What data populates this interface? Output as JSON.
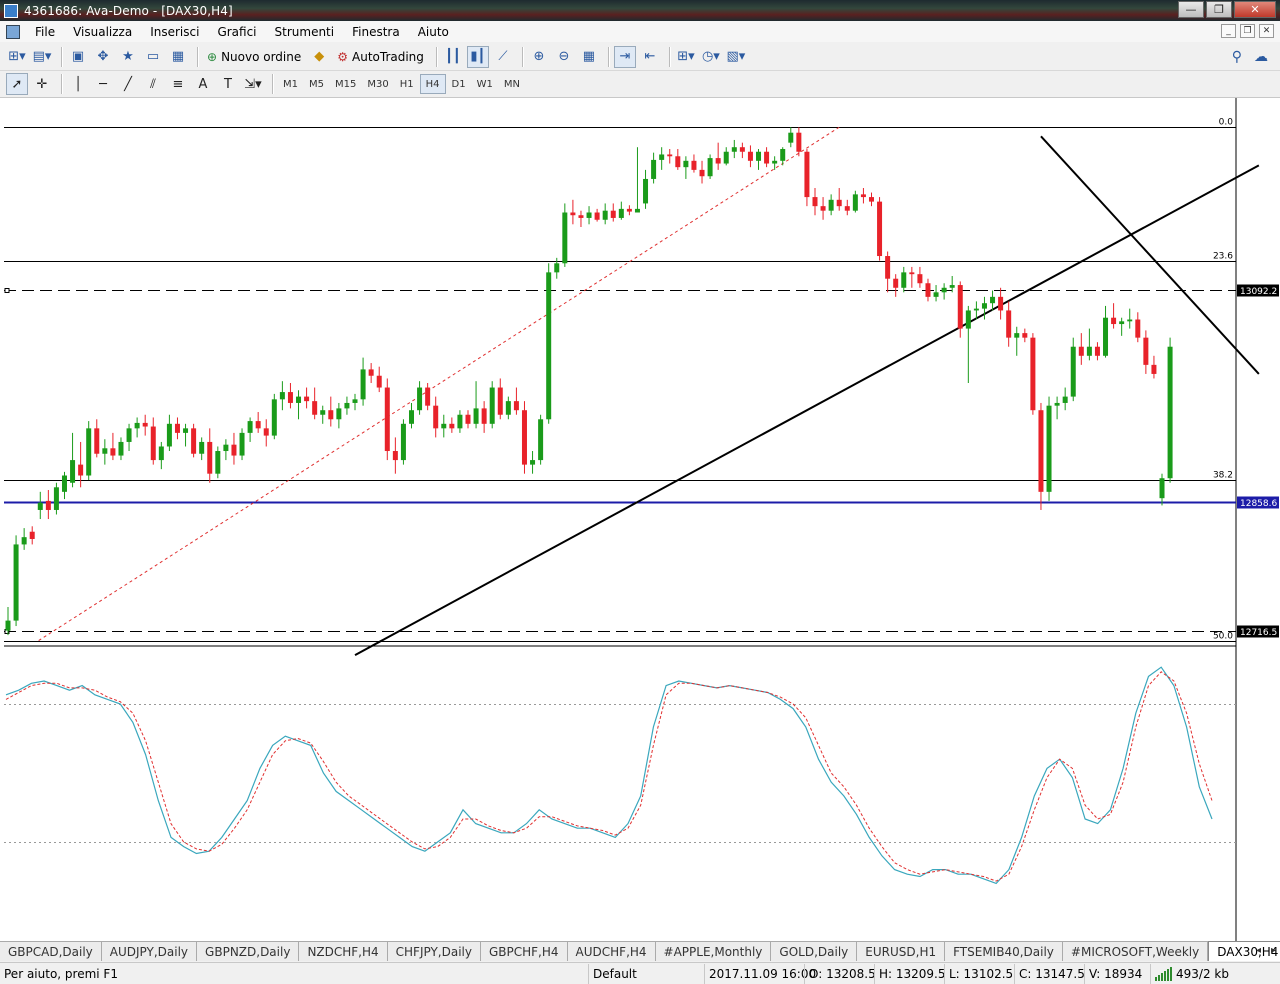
{
  "window": {
    "title": "4361686: Ava-Demo - [DAX30,H4]",
    "buttons": {
      "minimize": "—",
      "restore": "❐",
      "close": "✕"
    }
  },
  "menu": {
    "items": [
      "File",
      "Visualizza",
      "Inserisci",
      "Grafici",
      "Strumenti",
      "Finestra",
      "Aiuto"
    ]
  },
  "toolbar": {
    "new_order": "Nuovo ordine",
    "autotrading": "AutoTrading",
    "timeframes": [
      "M1",
      "M5",
      "M15",
      "M30",
      "H1",
      "H4",
      "D1",
      "W1",
      "MN"
    ],
    "active_timeframe": "H4"
  },
  "chart_data": {
    "type": "candlestick",
    "symbol": "DAX30",
    "timeframe": "H4",
    "price_range": [
      12700,
      13280
    ],
    "indicator_range": [
      0,
      100
    ],
    "fib_levels": [
      {
        "label": "0.0",
        "price": 13272
      },
      {
        "label": "23.6",
        "price": 13124
      },
      {
        "label": "38.2",
        "price": 12883
      },
      {
        "label": "50.0",
        "price": 12706
      }
    ],
    "price_labels": [
      {
        "text": "13092.2",
        "price": 13092.2,
        "style": "dash"
      },
      {
        "text": "12858.6",
        "price": 12858.6,
        "style": "blue"
      },
      {
        "text": "12716.5",
        "price": 12716.5,
        "style": "dash"
      }
    ],
    "candles": [
      {
        "o": 12717,
        "h": 12743,
        "l": 12712,
        "c": 12728
      },
      {
        "o": 12728,
        "h": 12822,
        "l": 12722,
        "c": 12812
      },
      {
        "o": 12812,
        "h": 12830,
        "l": 12806,
        "c": 12820
      },
      {
        "o": 12826,
        "h": 12832,
        "l": 12812,
        "c": 12818
      },
      {
        "o": 12850,
        "h": 12870,
        "l": 12840,
        "c": 12858
      },
      {
        "o": 12860,
        "h": 12872,
        "l": 12840,
        "c": 12850
      },
      {
        "o": 12850,
        "h": 12880,
        "l": 12845,
        "c": 12875
      },
      {
        "o": 12870,
        "h": 12892,
        "l": 12862,
        "c": 12888
      },
      {
        "o": 12880,
        "h": 12935,
        "l": 12875,
        "c": 12905
      },
      {
        "o": 12900,
        "h": 12925,
        "l": 12875,
        "c": 12888
      },
      {
        "o": 12888,
        "h": 12948,
        "l": 12883,
        "c": 12940
      },
      {
        "o": 12940,
        "h": 12950,
        "l": 12908,
        "c": 12912
      },
      {
        "o": 12912,
        "h": 12928,
        "l": 12900,
        "c": 12918
      },
      {
        "o": 12918,
        "h": 12935,
        "l": 12905,
        "c": 12910
      },
      {
        "o": 12910,
        "h": 12930,
        "l": 12905,
        "c": 12925
      },
      {
        "o": 12925,
        "h": 12945,
        "l": 12915,
        "c": 12940
      },
      {
        "o": 12940,
        "h": 12952,
        "l": 12930,
        "c": 12946
      },
      {
        "o": 12946,
        "h": 12955,
        "l": 12932,
        "c": 12942
      },
      {
        "o": 12942,
        "h": 12952,
        "l": 12900,
        "c": 12905
      },
      {
        "o": 12905,
        "h": 12925,
        "l": 12895,
        "c": 12920
      },
      {
        "o": 12920,
        "h": 12955,
        "l": 12915,
        "c": 12945
      },
      {
        "o": 12945,
        "h": 12952,
        "l": 12928,
        "c": 12935
      },
      {
        "o": 12935,
        "h": 12945,
        "l": 12920,
        "c": 12940
      },
      {
        "o": 12940,
        "h": 12945,
        "l": 12908,
        "c": 12912
      },
      {
        "o": 12912,
        "h": 12930,
        "l": 12905,
        "c": 12925
      },
      {
        "o": 12925,
        "h": 12940,
        "l": 12880,
        "c": 12890
      },
      {
        "o": 12890,
        "h": 12920,
        "l": 12885,
        "c": 12915
      },
      {
        "o": 12915,
        "h": 12928,
        "l": 12905,
        "c": 12922
      },
      {
        "o": 12922,
        "h": 12935,
        "l": 12900,
        "c": 12910
      },
      {
        "o": 12910,
        "h": 12940,
        "l": 12905,
        "c": 12935
      },
      {
        "o": 12935,
        "h": 12952,
        "l": 12925,
        "c": 12948
      },
      {
        "o": 12948,
        "h": 12958,
        "l": 12935,
        "c": 12940
      },
      {
        "o": 12940,
        "h": 12950,
        "l": 12920,
        "c": 12932
      },
      {
        "o": 12932,
        "h": 12978,
        "l": 12928,
        "c": 12972
      },
      {
        "o": 12972,
        "h": 12992,
        "l": 12960,
        "c": 12980
      },
      {
        "o": 12980,
        "h": 12990,
        "l": 12962,
        "c": 12968
      },
      {
        "o": 12968,
        "h": 12982,
        "l": 12950,
        "c": 12975
      },
      {
        "o": 12975,
        "h": 12985,
        "l": 12962,
        "c": 12970
      },
      {
        "o": 12970,
        "h": 12985,
        "l": 12950,
        "c": 12955
      },
      {
        "o": 12955,
        "h": 12965,
        "l": 12945,
        "c": 12960
      },
      {
        "o": 12960,
        "h": 12975,
        "l": 12942,
        "c": 12950
      },
      {
        "o": 12950,
        "h": 12968,
        "l": 12940,
        "c": 12962
      },
      {
        "o": 12962,
        "h": 12975,
        "l": 12955,
        "c": 12968
      },
      {
        "o": 12968,
        "h": 12978,
        "l": 12960,
        "c": 12972
      },
      {
        "o": 12972,
        "h": 13018,
        "l": 12965,
        "c": 13005
      },
      {
        "o": 13005,
        "h": 13012,
        "l": 12990,
        "c": 12998
      },
      {
        "o": 12998,
        "h": 13008,
        "l": 12980,
        "c": 12985
      },
      {
        "o": 12985,
        "h": 12995,
        "l": 12905,
        "c": 12915
      },
      {
        "o": 12915,
        "h": 12930,
        "l": 12890,
        "c": 12905
      },
      {
        "o": 12905,
        "h": 12950,
        "l": 12900,
        "c": 12945
      },
      {
        "o": 12945,
        "h": 12968,
        "l": 12940,
        "c": 12960
      },
      {
        "o": 12960,
        "h": 12992,
        "l": 12955,
        "c": 12985
      },
      {
        "o": 12985,
        "h": 12990,
        "l": 12960,
        "c": 12965
      },
      {
        "o": 12965,
        "h": 12975,
        "l": 12930,
        "c": 12940
      },
      {
        "o": 12940,
        "h": 12955,
        "l": 12930,
        "c": 12945
      },
      {
        "o": 12945,
        "h": 12952,
        "l": 12935,
        "c": 12940
      },
      {
        "o": 12940,
        "h": 12960,
        "l": 12935,
        "c": 12955
      },
      {
        "o": 12955,
        "h": 12960,
        "l": 12940,
        "c": 12945
      },
      {
        "o": 12945,
        "h": 12992,
        "l": 12940,
        "c": 12962
      },
      {
        "o": 12962,
        "h": 12970,
        "l": 12935,
        "c": 12945
      },
      {
        "o": 12945,
        "h": 12992,
        "l": 12940,
        "c": 12985
      },
      {
        "o": 12985,
        "h": 12995,
        "l": 12950,
        "c": 12955
      },
      {
        "o": 12955,
        "h": 12975,
        "l": 12950,
        "c": 12970
      },
      {
        "o": 12970,
        "h": 12985,
        "l": 12955,
        "c": 12960
      },
      {
        "o": 12960,
        "h": 12970,
        "l": 12890,
        "c": 12900
      },
      {
        "o": 12900,
        "h": 12915,
        "l": 12890,
        "c": 12905
      },
      {
        "o": 12905,
        "h": 12955,
        "l": 12900,
        "c": 12950
      },
      {
        "o": 12950,
        "h": 13122,
        "l": 12945,
        "c": 13112
      },
      {
        "o": 13112,
        "h": 13128,
        "l": 13105,
        "c": 13122
      },
      {
        "o": 13122,
        "h": 13188,
        "l": 13118,
        "c": 13178
      },
      {
        "o": 13178,
        "h": 13192,
        "l": 13165,
        "c": 13175
      },
      {
        "o": 13175,
        "h": 13180,
        "l": 13162,
        "c": 13172
      },
      {
        "o": 13172,
        "h": 13185,
        "l": 13165,
        "c": 13178
      },
      {
        "o": 13178,
        "h": 13182,
        "l": 13168,
        "c": 13170
      },
      {
        "o": 13170,
        "h": 13188,
        "l": 13165,
        "c": 13180
      },
      {
        "o": 13180,
        "h": 13188,
        "l": 13168,
        "c": 13172
      },
      {
        "o": 13172,
        "h": 13190,
        "l": 13170,
        "c": 13182
      },
      {
        "o": 13182,
        "h": 13186,
        "l": 13175,
        "c": 13179
      },
      {
        "o": 13178,
        "h": 13250,
        "l": 13178,
        "c": 13182
      },
      {
        "o": 13188,
        "h": 13225,
        "l": 13182,
        "c": 13215
      },
      {
        "o": 13215,
        "h": 13244,
        "l": 13210,
        "c": 13236
      },
      {
        "o": 13236,
        "h": 13250,
        "l": 13225,
        "c": 13242
      },
      {
        "o": 13242,
        "h": 13248,
        "l": 13232,
        "c": 13240
      },
      {
        "o": 13240,
        "h": 13248,
        "l": 13225,
        "c": 13228
      },
      {
        "o": 13228,
        "h": 13240,
        "l": 13215,
        "c": 13235
      },
      {
        "o": 13235,
        "h": 13242,
        "l": 13222,
        "c": 13225
      },
      {
        "o": 13225,
        "h": 13235,
        "l": 13210,
        "c": 13218
      },
      {
        "o": 13218,
        "h": 13242,
        "l": 13215,
        "c": 13238
      },
      {
        "o": 13238,
        "h": 13255,
        "l": 13225,
        "c": 13232
      },
      {
        "o": 13232,
        "h": 13250,
        "l": 13230,
        "c": 13245
      },
      {
        "o": 13245,
        "h": 13258,
        "l": 13238,
        "c": 13250
      },
      {
        "o": 13250,
        "h": 13255,
        "l": 13238,
        "c": 13245
      },
      {
        "o": 13245,
        "h": 13252,
        "l": 13228,
        "c": 13235
      },
      {
        "o": 13235,
        "h": 13248,
        "l": 13225,
        "c": 13245
      },
      {
        "o": 13245,
        "h": 13250,
        "l": 13228,
        "c": 13232
      },
      {
        "o": 13232,
        "h": 13240,
        "l": 13225,
        "c": 13235
      },
      {
        "o": 13235,
        "h": 13250,
        "l": 13230,
        "c": 13248
      },
      {
        "o": 13255,
        "h": 13272,
        "l": 13250,
        "c": 13266
      },
      {
        "o": 13266,
        "h": 13272,
        "l": 13240,
        "c": 13245
      },
      {
        "o": 13245,
        "h": 13248,
        "l": 13185,
        "c": 13195
      },
      {
        "o": 13195,
        "h": 13205,
        "l": 13175,
        "c": 13185
      },
      {
        "o": 13185,
        "h": 13195,
        "l": 13170,
        "c": 13180
      },
      {
        "o": 13180,
        "h": 13198,
        "l": 13175,
        "c": 13192
      },
      {
        "o": 13192,
        "h": 13205,
        "l": 13180,
        "c": 13185
      },
      {
        "o": 13185,
        "h": 13192,
        "l": 13175,
        "c": 13180
      },
      {
        "o": 13180,
        "h": 13202,
        "l": 13178,
        "c": 13198
      },
      {
        "o": 13198,
        "h": 13205,
        "l": 13188,
        "c": 13195
      },
      {
        "o": 13195,
        "h": 13200,
        "l": 13185,
        "c": 13190
      },
      {
        "o": 13190,
        "h": 13195,
        "l": 13125,
        "c": 13130
      },
      {
        "o": 13130,
        "h": 13135,
        "l": 13090,
        "c": 13105
      },
      {
        "o": 13105,
        "h": 13110,
        "l": 13085,
        "c": 13095
      },
      {
        "o": 13095,
        "h": 13118,
        "l": 13090,
        "c": 13112
      },
      {
        "o": 13112,
        "h": 13118,
        "l": 13095,
        "c": 13110
      },
      {
        "o": 13110,
        "h": 13118,
        "l": 13095,
        "c": 13100
      },
      {
        "o": 13100,
        "h": 13105,
        "l": 13080,
        "c": 13085
      },
      {
        "o": 13085,
        "h": 13098,
        "l": 13080,
        "c": 13090
      },
      {
        "o": 13090,
        "h": 13100,
        "l": 13082,
        "c": 13095
      },
      {
        "o": 13095,
        "h": 13108,
        "l": 13090,
        "c": 13098
      },
      {
        "o": 13098,
        "h": 13102,
        "l": 13040,
        "c": 13050
      },
      {
        "o": 13050,
        "h": 13075,
        "l": 12990,
        "c": 13070
      },
      {
        "o": 13070,
        "h": 13080,
        "l": 13060,
        "c": 13072
      },
      {
        "o": 13072,
        "h": 13085,
        "l": 13060,
        "c": 13078
      },
      {
        "o": 13078,
        "h": 13092,
        "l": 13070,
        "c": 13085
      },
      {
        "o": 13085,
        "h": 13095,
        "l": 13060,
        "c": 13070
      },
      {
        "o": 13070,
        "h": 13080,
        "l": 13030,
        "c": 13040
      },
      {
        "o": 13040,
        "h": 13052,
        "l": 13020,
        "c": 13045
      },
      {
        "o": 13045,
        "h": 13050,
        "l": 13035,
        "c": 13040
      },
      {
        "o": 13040,
        "h": 13045,
        "l": 12955,
        "c": 12960
      },
      {
        "o": 12960,
        "h": 12968,
        "l": 12850,
        "c": 12870
      },
      {
        "o": 12870,
        "h": 12975,
        "l": 12860,
        "c": 12965
      },
      {
        "o": 12965,
        "h": 12975,
        "l": 12950,
        "c": 12968
      },
      {
        "o": 12968,
        "h": 12985,
        "l": 12960,
        "c": 12975
      },
      {
        "o": 12975,
        "h": 13040,
        "l": 12970,
        "c": 13030
      },
      {
        "o": 13030,
        "h": 13045,
        "l": 13010,
        "c": 13020
      },
      {
        "o": 13020,
        "h": 13050,
        "l": 13015,
        "c": 13030
      },
      {
        "o": 13030,
        "h": 13035,
        "l": 13015,
        "c": 13020
      },
      {
        "o": 13020,
        "h": 13075,
        "l": 13018,
        "c": 13062
      },
      {
        "o": 13062,
        "h": 13078,
        "l": 13050,
        "c": 13055
      },
      {
        "o": 13055,
        "h": 13062,
        "l": 13042,
        "c": 13058
      },
      {
        "o": 13058,
        "h": 13072,
        "l": 13050,
        "c": 13060
      },
      {
        "o": 13060,
        "h": 13068,
        "l": 13035,
        "c": 13040
      },
      {
        "o": 13040,
        "h": 13048,
        "l": 13000,
        "c": 13010
      },
      {
        "o": 13010,
        "h": 13020,
        "l": 12995,
        "c": 13000
      },
      {
        "o": 12863,
        "h": 12890,
        "l": 12855,
        "c": 12885
      },
      {
        "o": 12885,
        "h": 13040,
        "l": 12880,
        "c": 13030
      }
    ],
    "trendlines": [
      {
        "name": "rising-trendline",
        "from": [
          43,
          12690
        ],
        "to": [
          155,
          13230
        ]
      },
      {
        "name": "falling-trendline",
        "from": [
          128,
          13262
        ],
        "to": [
          155,
          13000
        ]
      }
    ],
    "stochastic": {
      "main": [
        84,
        86,
        89,
        90,
        88,
        86,
        88,
        84,
        82,
        80,
        72,
        58,
        38,
        22,
        18,
        15,
        16,
        22,
        30,
        38,
        52,
        62,
        66,
        64,
        62,
        50,
        42,
        38,
        34,
        30,
        26,
        22,
        18,
        16,
        20,
        24,
        34,
        28,
        26,
        24,
        24,
        28,
        34,
        30,
        28,
        26,
        26,
        24,
        22,
        28,
        40,
        70,
        88,
        90,
        89,
        88,
        87,
        88,
        87,
        86,
        85,
        82,
        78,
        70,
        56,
        46,
        40,
        32,
        22,
        14,
        8,
        6,
        5,
        8,
        8,
        6,
        6,
        4,
        2,
        8,
        22,
        40,
        52,
        56,
        48,
        30,
        28,
        34,
        52,
        76,
        92,
        96,
        88,
        70,
        44,
        30
      ],
      "signal": [
        82,
        85,
        88,
        89,
        89,
        87,
        87,
        86,
        83,
        81,
        76,
        64,
        46,
        28,
        20,
        17,
        16,
        19,
        26,
        34,
        46,
        58,
        64,
        65,
        63,
        55,
        46,
        40,
        36,
        32,
        28,
        24,
        20,
        17,
        18,
        22,
        30,
        30,
        27,
        25,
        24,
        26,
        31,
        31,
        29,
        27,
        26,
        25,
        23,
        26,
        36,
        62,
        84,
        89,
        89,
        88,
        87,
        88,
        87,
        86,
        85,
        83,
        80,
        74,
        62,
        50,
        44,
        36,
        26,
        18,
        11,
        8,
        6,
        7,
        8,
        7,
        6,
        5,
        3,
        6,
        18,
        34,
        48,
        56,
        52,
        36,
        30,
        32,
        46,
        70,
        88,
        94,
        90,
        76,
        54,
        38
      ]
    }
  },
  "tabs": {
    "items": [
      "GBPCAD,Daily",
      "AUDJPY,Daily",
      "GBPNZD,Daily",
      "NZDCHF,H4",
      "CHFJPY,Daily",
      "GBPCHF,H4",
      "AUDCHF,H4",
      "#APPLE,Monthly",
      "GOLD,Daily",
      "EURUSD,H1",
      "FTSEMIB40,Daily",
      "#MICROSOFT,Weekly",
      "DAX30,H4"
    ],
    "active": "DAX30,H4"
  },
  "status": {
    "help": "Per aiuto, premi F1",
    "profile": "Default",
    "datetime": "2017.11.09 16:00",
    "open": "O: 13208.5",
    "high": "H: 13209.5",
    "low": "L: 13102.5",
    "close": "C: 13147.5",
    "volume": "V: 18934",
    "traffic": "493/2 kb"
  },
  "colors": {
    "bull": "#1a9b1a",
    "bear": "#e8222a",
    "trend": "#000000",
    "blue_line": "#1c1ca8",
    "stoch_main": "#3aa7bd",
    "stoch_signal": "#e03030"
  }
}
